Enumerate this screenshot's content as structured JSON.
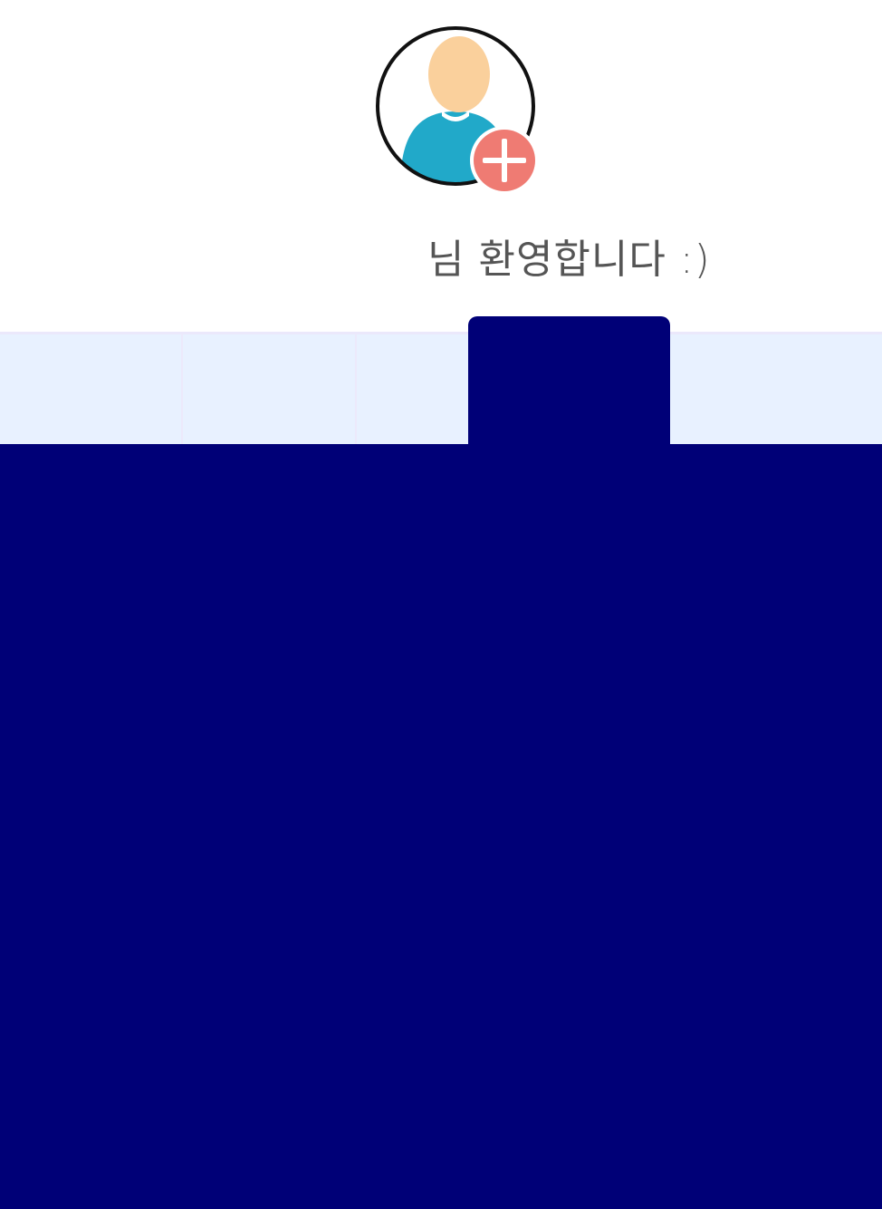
{
  "profile": {
    "user_name": "",
    "welcome_text": "님 환영합니다 :)",
    "avatar_icon": "user-avatar-icon",
    "add_icon": "plus-circle-icon",
    "colors": {
      "skin": "#fad09c",
      "shirt": "#21a9c9",
      "add_badge": "#ef7b73",
      "ring": "#111111"
    }
  },
  "tabs": {
    "background": "#e8f1ff",
    "active_tab_color": "#000077"
  },
  "panel": {
    "background": "#000077"
  }
}
